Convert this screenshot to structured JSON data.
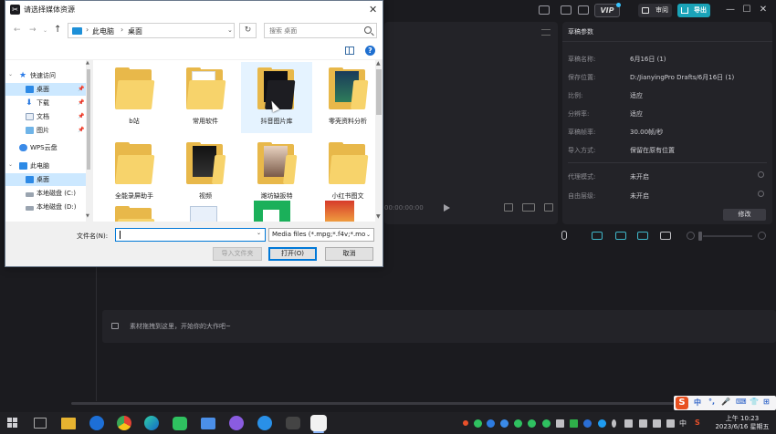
{
  "app": {
    "vip_label": "VIP",
    "review_label": "审阅",
    "export_label": "导出",
    "minimize": "—",
    "maximize": "☐",
    "close": "✕",
    "player_time": "00:00:00:00",
    "drop_hint": "素材拖拽到这里，开始你的大作吧~",
    "accent_color": "#1aa3b8"
  },
  "draft_panel": {
    "title": "草稿参数",
    "rows": [
      {
        "label": "草稿名称:",
        "value": "6月16日 (1)"
      },
      {
        "label": "保存位置:",
        "value": "D:/JianyingPro Drafts/6月16日 (1)"
      },
      {
        "label": "比例:",
        "value": "适应"
      },
      {
        "label": "分辨率:",
        "value": "适应"
      },
      {
        "label": "草稿帧率:",
        "value": "30.00帧/秒"
      },
      {
        "label": "导入方式:",
        "value": "保留在原有位置"
      },
      {
        "label": "代理模式:",
        "value": "未开启"
      },
      {
        "label": "自由层级:",
        "value": "未开启"
      }
    ],
    "modify_button": "修改"
  },
  "dialog": {
    "title": "请选择媒体资源",
    "close": "✕",
    "breadcrumb": [
      "此电脑",
      "桌面"
    ],
    "search_placeholder": "搜索 桌面",
    "nav_items": [
      {
        "label": "快速访问",
        "icon": "star-icon"
      },
      {
        "label": "桌面",
        "icon": "desktop-icon"
      },
      {
        "label": "下载",
        "icon": "download-icon"
      },
      {
        "label": "文档",
        "icon": "document-icon"
      },
      {
        "label": "图片",
        "icon": "picture-icon"
      },
      {
        "label": "WPS云盘",
        "icon": "cloud-icon"
      },
      {
        "label": "此电脑",
        "icon": "computer-icon"
      },
      {
        "label": "桌面",
        "icon": "desktop-icon"
      },
      {
        "label": "本地磁盘 (C:)",
        "icon": "drive-icon"
      },
      {
        "label": "本地磁盘 (D:)",
        "icon": "drive-icon"
      }
    ],
    "folders": [
      {
        "label": "b站"
      },
      {
        "label": "常用软件"
      },
      {
        "label": "抖音图片库"
      },
      {
        "label": "零壳资料分析"
      },
      {
        "label": "全能录屏助手"
      },
      {
        "label": "视频"
      },
      {
        "label": "潍坊缺扳特"
      },
      {
        "label": "小红书图文"
      },
      {
        "label": ""
      },
      {
        "label": ""
      },
      {
        "label": ""
      },
      {
        "label": ""
      }
    ],
    "filename_label": "文件名(N):",
    "filename_value": "",
    "filter_value": "Media files (*.mpg;*.f4v;*.mo",
    "import_folder_button": "导入文件夹",
    "open_button": "打开(O)",
    "cancel_button": "取消"
  },
  "ime": {
    "logo": "S",
    "items": [
      "中",
      "°,",
      "🎤",
      "⌨",
      "👕",
      "⊞"
    ]
  },
  "taskbar": {
    "clock_time": "上午 10:23",
    "clock_date": "2023/6/16 星期五",
    "lang": "中",
    "tray_s": "S"
  }
}
